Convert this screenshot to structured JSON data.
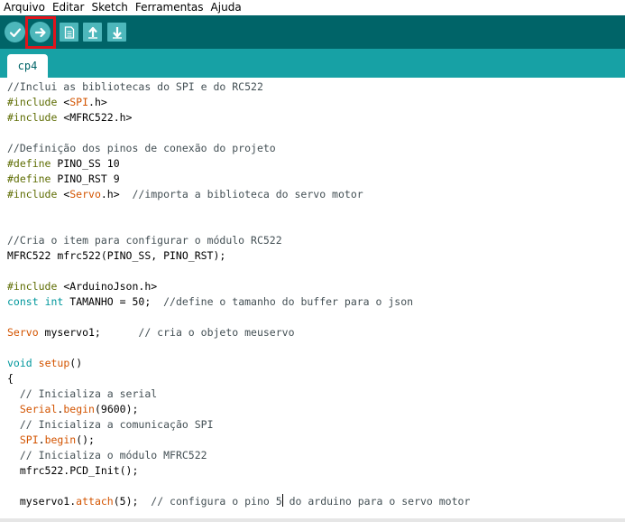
{
  "menu": {
    "items": [
      "Arquivo",
      "Editar",
      "Sketch",
      "Ferramentas",
      "Ajuda"
    ]
  },
  "toolbar": {
    "buttons": [
      {
        "name": "verify",
        "icon": "check-icon"
      },
      {
        "name": "upload",
        "icon": "arrow-right-icon"
      },
      {
        "name": "new",
        "icon": "document-icon"
      },
      {
        "name": "open",
        "icon": "arrow-up-icon"
      },
      {
        "name": "save",
        "icon": "arrow-down-icon"
      }
    ]
  },
  "tab": {
    "label": "cp4"
  },
  "colors": {
    "toolbar_bg": "#006468",
    "tabstrip_bg": "#17a1a5",
    "button_bg": "#4db7bb",
    "highlight": "#e0141c",
    "comment": "#434f54",
    "preprocessor": "#5e6d03",
    "keyword": "#00979c",
    "library": "#d35400"
  },
  "code": {
    "lines": [
      [
        {
          "t": "//Inclui as bibliotecas do SPI e do RC522",
          "c": "comment"
        }
      ],
      [
        {
          "t": "#include ",
          "c": "pre"
        },
        {
          "t": "<",
          "c": "plain"
        },
        {
          "t": "SPI",
          "c": "lib"
        },
        {
          "t": ".h>",
          "c": "plain"
        }
      ],
      [
        {
          "t": "#include ",
          "c": "pre"
        },
        {
          "t": "<MFRC522.h>",
          "c": "plain"
        }
      ],
      [],
      [
        {
          "t": "//Definição dos pinos de conexão do projeto",
          "c": "comment"
        }
      ],
      [
        {
          "t": "#define ",
          "c": "pre"
        },
        {
          "t": "PINO_SS 10",
          "c": "plain"
        }
      ],
      [
        {
          "t": "#define ",
          "c": "pre"
        },
        {
          "t": "PINO_RST 9",
          "c": "plain"
        }
      ],
      [
        {
          "t": "#include ",
          "c": "pre"
        },
        {
          "t": "<",
          "c": "plain"
        },
        {
          "t": "Servo",
          "c": "lib"
        },
        {
          "t": ".h>  ",
          "c": "plain"
        },
        {
          "t": "//importa a biblioteca do servo motor",
          "c": "comment"
        }
      ],
      [],
      [],
      [
        {
          "t": "//Cria o item para configurar o módulo RC522",
          "c": "comment"
        }
      ],
      [
        {
          "t": "MFRC522 mfrc522(PINO_SS, PINO_RST);",
          "c": "plain"
        }
      ],
      [],
      [
        {
          "t": "#include ",
          "c": "pre"
        },
        {
          "t": "<ArduinoJson.h>",
          "c": "plain"
        }
      ],
      [
        {
          "t": "const",
          "c": "kw"
        },
        {
          "t": " ",
          "c": "plain"
        },
        {
          "t": "int",
          "c": "kw"
        },
        {
          "t": " TAMANHO = 50;  ",
          "c": "plain"
        },
        {
          "t": "//define o tamanho do buffer para o json",
          "c": "comment"
        }
      ],
      [],
      [
        {
          "t": "Servo",
          "c": "lib"
        },
        {
          "t": " myservo1;      ",
          "c": "plain"
        },
        {
          "t": "// cria o objeto meuservo",
          "c": "comment"
        }
      ],
      [],
      [
        {
          "t": "void",
          "c": "kw"
        },
        {
          "t": " ",
          "c": "plain"
        },
        {
          "t": "setup",
          "c": "lib"
        },
        {
          "t": "()",
          "c": "plain"
        }
      ],
      [
        {
          "t": "{",
          "c": "plain"
        }
      ],
      [
        {
          "t": "  ",
          "c": "plain"
        },
        {
          "t": "// Inicializa a serial",
          "c": "comment"
        }
      ],
      [
        {
          "t": "  ",
          "c": "plain"
        },
        {
          "t": "Serial",
          "c": "lib"
        },
        {
          "t": ".",
          "c": "plain"
        },
        {
          "t": "begin",
          "c": "lib"
        },
        {
          "t": "(9600);",
          "c": "plain"
        }
      ],
      [
        {
          "t": "  ",
          "c": "plain"
        },
        {
          "t": "// Inicializa a comunicação SPI",
          "c": "comment"
        }
      ],
      [
        {
          "t": "  ",
          "c": "plain"
        },
        {
          "t": "SPI",
          "c": "lib"
        },
        {
          "t": ".",
          "c": "plain"
        },
        {
          "t": "begin",
          "c": "lib"
        },
        {
          "t": "();",
          "c": "plain"
        }
      ],
      [
        {
          "t": "  ",
          "c": "plain"
        },
        {
          "t": "// Inicializa o módulo MFRC522",
          "c": "comment"
        }
      ],
      [
        {
          "t": "  mfrc522.PCD_Init();",
          "c": "plain"
        }
      ],
      [],
      [
        {
          "t": "  myservo1.",
          "c": "plain"
        },
        {
          "t": "attach",
          "c": "lib"
        },
        {
          "t": "(5);  ",
          "c": "plain"
        },
        {
          "t": "// configura o pino 5",
          "c": "comment"
        },
        {
          "t": "|caret|",
          "c": "caret"
        },
        {
          "t": " do arduino para o servo motor",
          "c": "comment"
        }
      ]
    ]
  }
}
